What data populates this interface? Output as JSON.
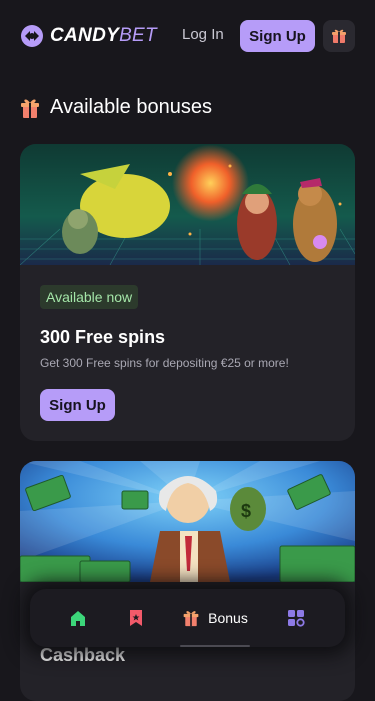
{
  "header": {
    "logo_text_a": "CANDY",
    "logo_text_b": "BET",
    "login_label": "Log In",
    "signup_label": "Sign Up",
    "gift_icon": "gift-icon"
  },
  "section": {
    "title": "Available bonuses",
    "icon": "gift-icon"
  },
  "cards": [
    {
      "badge": "Available now",
      "title": "300 Free spins",
      "description": "Get 300 Free spins for depositing €25 or more!",
      "button_label": "Sign Up"
    },
    {
      "title": "Cashback"
    }
  ],
  "bottom_nav": {
    "items": [
      {
        "icon": "home-icon"
      },
      {
        "icon": "bookmark-icon"
      },
      {
        "icon": "gift-icon",
        "label": "Bonus"
      },
      {
        "icon": "grid-icon"
      }
    ]
  },
  "colors": {
    "background": "#18171c",
    "accent": "#b69cf8",
    "badge_bg": "#2c3a2c",
    "badge_text": "#a4e6a8",
    "card_bg": "#232228"
  }
}
